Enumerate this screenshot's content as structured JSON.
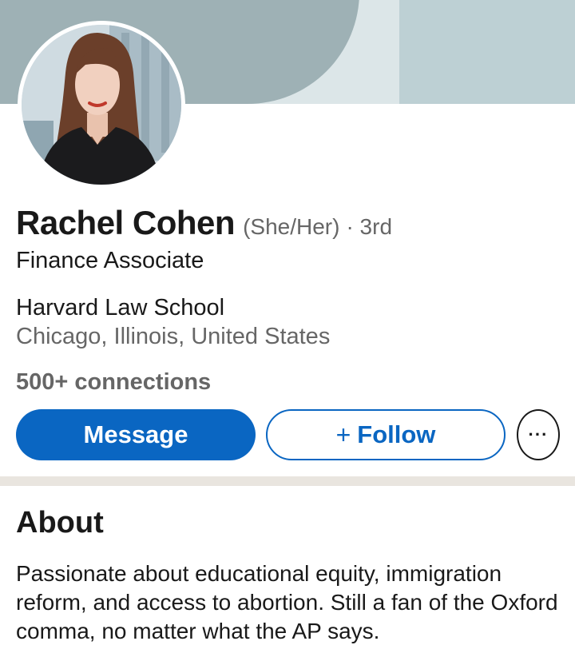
{
  "profile": {
    "name": "Rachel Cohen",
    "pronouns": "(She/Her)",
    "degree": "· 3rd",
    "headline": "Finance Associate",
    "school": "Harvard Law School",
    "location": "Chicago, Illinois, United States",
    "connections": "500+ connections"
  },
  "actions": {
    "message_label": "Message",
    "follow_plus": "+",
    "follow_label": "Follow",
    "more_label": "···"
  },
  "about": {
    "title": "About",
    "text": "Passionate about educational equity, immigration reform, and access to abortion. Still a fan of the Oxford comma, no matter what the AP says."
  },
  "colors": {
    "accent": "#0a66c2",
    "banner_dark": "#9eb1b5",
    "banner_light": "#bdd0d4",
    "divider": "#e9e5df"
  },
  "icons": {
    "more": "more-horizontal-icon"
  }
}
